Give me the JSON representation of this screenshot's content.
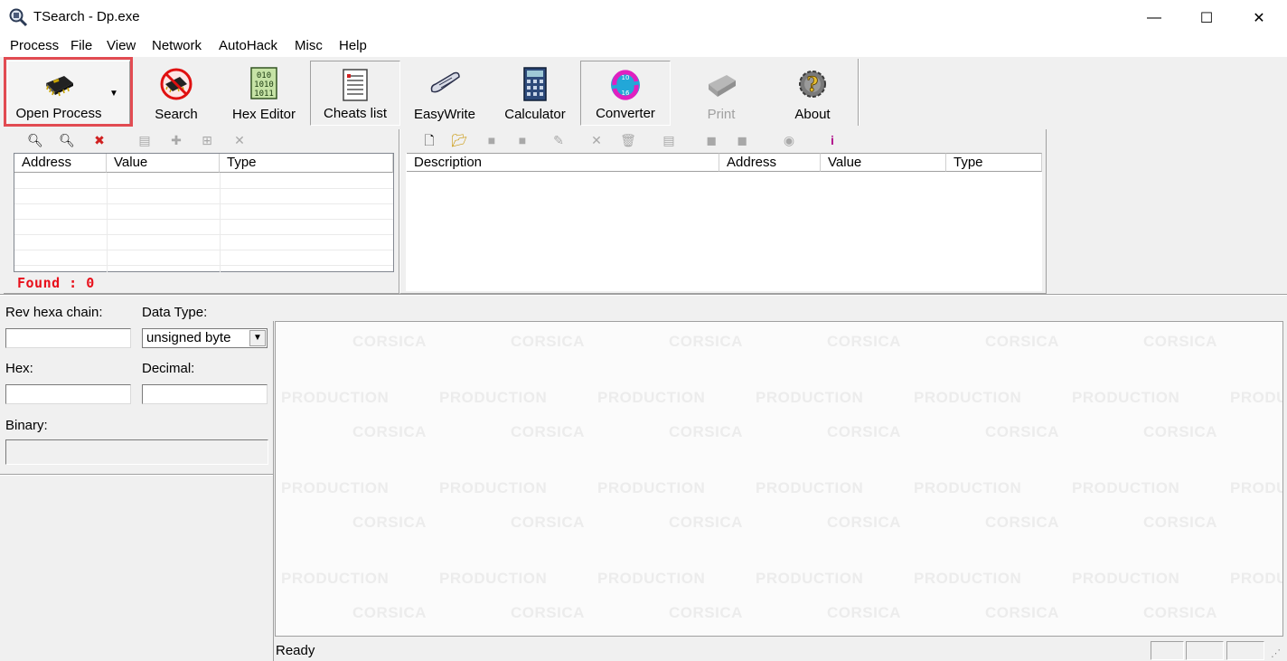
{
  "window": {
    "title": "TSearch - Dp.exe",
    "controls": {
      "minimize": "—",
      "maximize": "☐",
      "close": "✕"
    }
  },
  "menu": [
    "Process",
    "File",
    "View",
    "Network",
    "AutoHack",
    "Misc",
    "Help"
  ],
  "toolbar": {
    "open_process": "Open Process",
    "search": "Search",
    "hex_editor": "Hex Editor",
    "cheats_list": "Cheats list",
    "easywrite": "EasyWrite",
    "calculator": "Calculator",
    "converter": "Converter",
    "print": "Print",
    "about": "About"
  },
  "search_list": {
    "columns": [
      "Address",
      "Value",
      "Type"
    ],
    "found_label": "Found : 0"
  },
  "cheat_list": {
    "columns": [
      "Description",
      "Address",
      "Value",
      "Type"
    ]
  },
  "converter_panel": {
    "rev_hexa_label": "Rev hexa chain:",
    "data_type_label": "Data Type:",
    "data_type_value": "unsigned byte",
    "hex_label": "Hex:",
    "decimal_label": "Decimal:",
    "binary_label": "Binary:"
  },
  "watermark": {
    "line1": "CORSICA",
    "line2": "PRODUCTION",
    "line2_partial": "PRODU"
  },
  "status_bar": {
    "text": "Ready"
  },
  "colors": {
    "highlight": "#e24b52",
    "found_text": "#e8101b"
  }
}
